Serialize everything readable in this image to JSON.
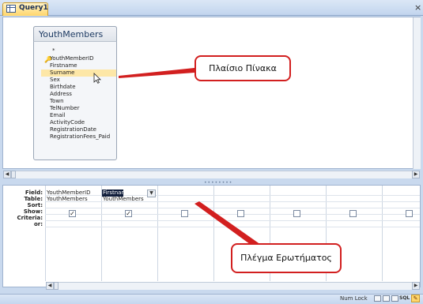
{
  "tab": {
    "label": "Query1",
    "close": "×"
  },
  "table": {
    "name": "YouthMembers",
    "fields": [
      "*",
      "YouthMemberID",
      "Firstname",
      "Surname",
      "Sex",
      "Birthdate",
      "Address",
      "Town",
      "TelNumber",
      "Email",
      "ActivityCode",
      "RegistrationDate",
      "RegistrationFees_Paid"
    ],
    "selected_field": "Surname"
  },
  "grid": {
    "row_labels": [
      "Field:",
      "Table:",
      "Sort:",
      "Show:",
      "Criteria:",
      "or:"
    ],
    "columns": [
      {
        "field": "YouthMemberID",
        "table": "YouthMembers",
        "show": true
      },
      {
        "field": "Firstname",
        "table": "YouthMembers",
        "show": true
      },
      {
        "field": "",
        "table": "",
        "show": false
      },
      {
        "field": "",
        "table": "",
        "show": false
      },
      {
        "field": "",
        "table": "",
        "show": false
      },
      {
        "field": "",
        "table": "",
        "show": false
      },
      {
        "field": "",
        "table": "",
        "show": false
      },
      {
        "field": "",
        "table": "",
        "show": false
      }
    ]
  },
  "callouts": {
    "table_pane": "Πλαίσιο Πίνακα",
    "query_grid": "Πλέγμα Ερωτήματος"
  },
  "status": {
    "num_lock": "Num Lock",
    "sql": "SQL"
  },
  "colors": {
    "callout_border": "#d21f1f",
    "tab_active": "#ffd66b",
    "chrome": "#c9d9ee"
  }
}
